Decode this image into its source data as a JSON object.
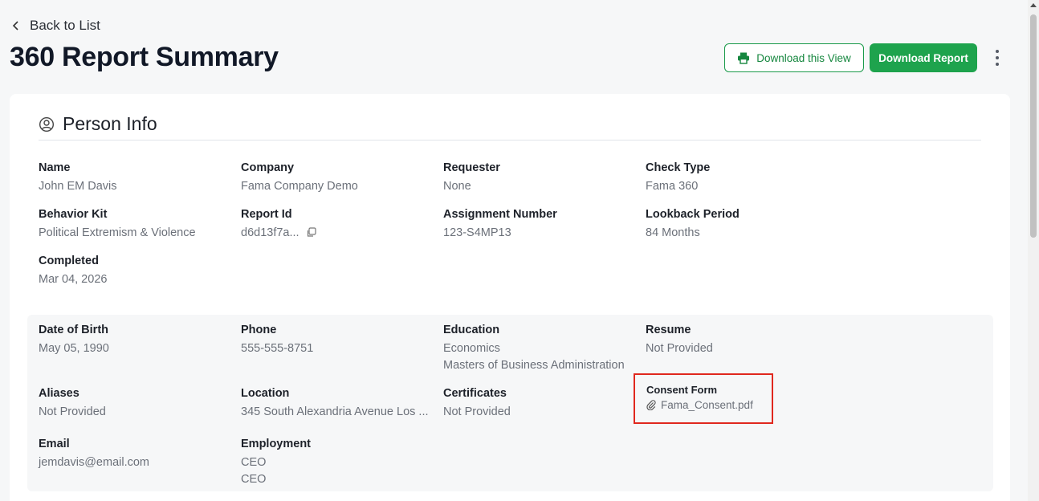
{
  "nav": {
    "back_label": "Back to List"
  },
  "page": {
    "title": "360 Report Summary"
  },
  "actions": {
    "download_view_label": "Download this View",
    "download_report_label": "Download Report"
  },
  "colors": {
    "accent": "#1ea34d",
    "highlight": "#e0281e"
  },
  "person_info": {
    "title": "Person Info",
    "name": {
      "label": "Name",
      "value": "John EM Davis"
    },
    "company": {
      "label": "Company",
      "value": "Fama Company Demo"
    },
    "requester": {
      "label": "Requester",
      "value": "None"
    },
    "check_type": {
      "label": "Check Type",
      "value": "Fama 360"
    },
    "behavior_kit": {
      "label": "Behavior Kit",
      "value": "Political Extremism & Violence"
    },
    "report_id": {
      "label": "Report Id",
      "value": "d6d13f7a..."
    },
    "assignment_number": {
      "label": "Assignment Number",
      "value": "123-S4MP13"
    },
    "lookback_period": {
      "label": "Lookback Period",
      "value": "84 Months"
    },
    "completed": {
      "label": "Completed",
      "value": "Mar 04, 2026"
    }
  },
  "details": {
    "dob": {
      "label": "Date of Birth",
      "value": "May 05, 1990"
    },
    "phone": {
      "label": "Phone",
      "value": "555-555-8751"
    },
    "education": {
      "label": "Education",
      "values": [
        "Economics",
        "Masters of Business Administration"
      ]
    },
    "resume": {
      "label": "Resume",
      "value": "Not Provided"
    },
    "aliases": {
      "label": "Aliases",
      "value": "Not Provided"
    },
    "location": {
      "label": "Location",
      "value": "345 South Alexandria Avenue Los ..."
    },
    "certificates": {
      "label": "Certificates",
      "value": "Not Provided"
    },
    "consent_form": {
      "label": "Consent Form",
      "file": "Fama_Consent.pdf"
    },
    "email": {
      "label": "Email",
      "value": "jemdavis@email.com"
    },
    "employment": {
      "label": "Employment",
      "values": [
        "CEO",
        "CEO"
      ]
    }
  }
}
